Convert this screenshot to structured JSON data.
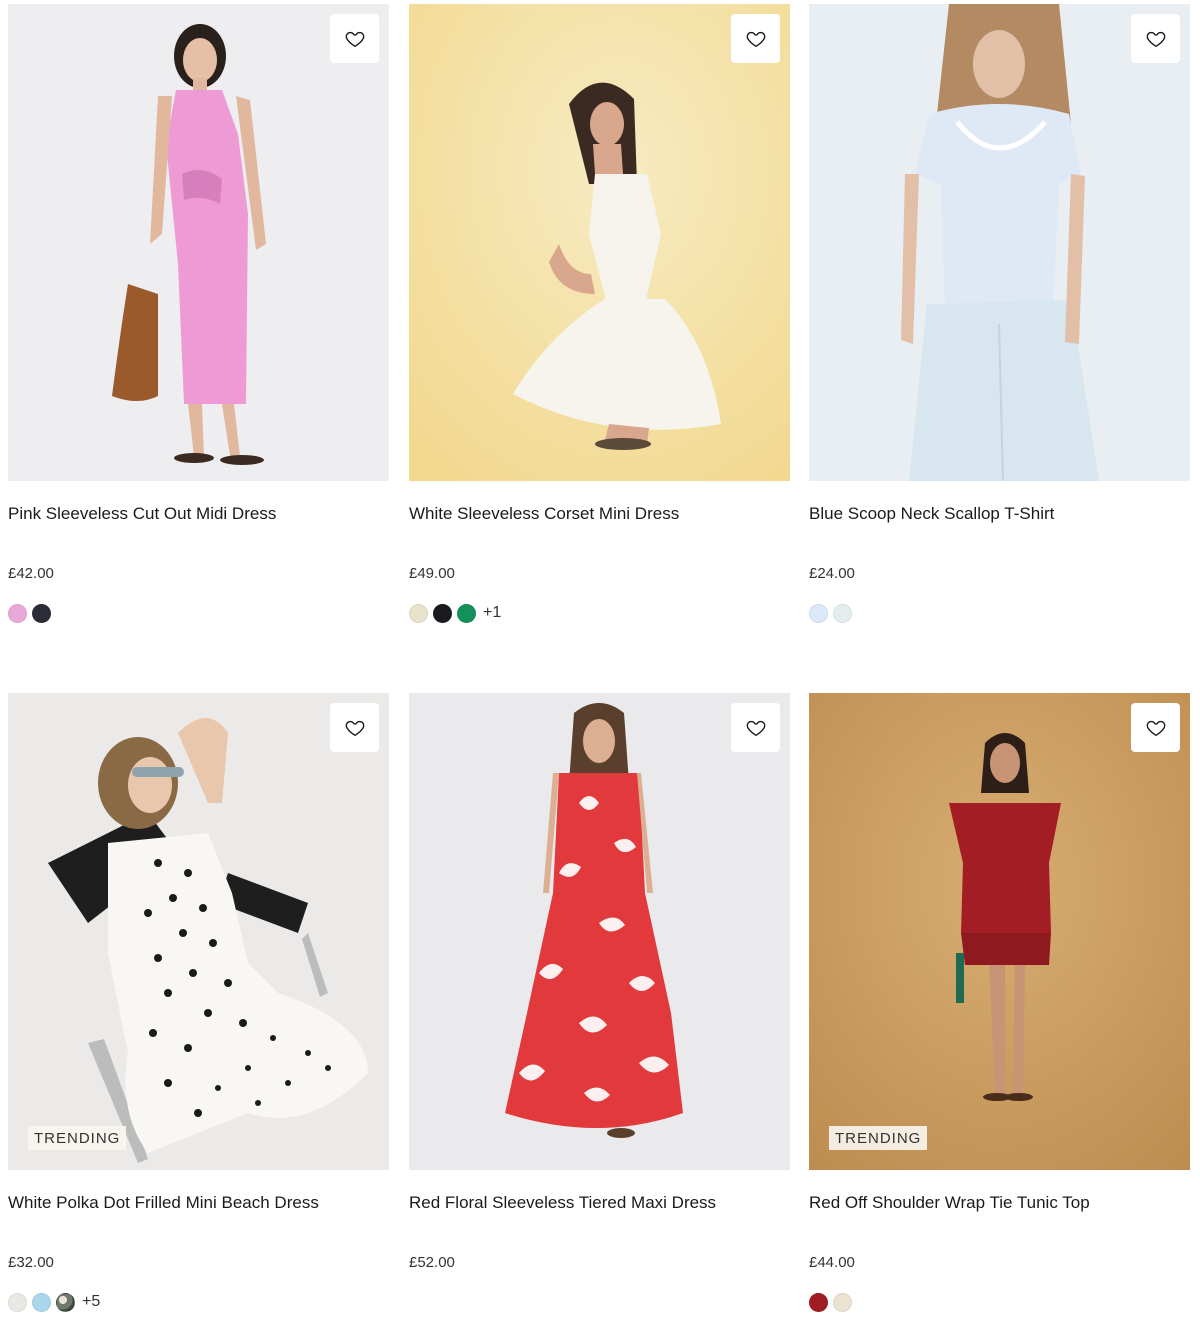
{
  "products": [
    {
      "title": "Pink Sleeveless Cut Out Midi Dress",
      "price": "£42.00",
      "badge": "",
      "image_bg": "#eeeef0",
      "swatches": [
        "#e9a9d8",
        "#2b2c38"
      ],
      "more": ""
    },
    {
      "title": "White Sleeveless Corset Mini Dress",
      "price": "£49.00",
      "badge": "",
      "image_bg": "#f4e2a9",
      "swatches": [
        "#e7e2cc",
        "#1b1b1f",
        "#14915a"
      ],
      "more": "+1"
    },
    {
      "title": "Blue Scoop Neck Scallop T-Shirt",
      "price": "£24.00",
      "badge": "",
      "image_bg": "#e9eef2",
      "swatches": [
        "#dbe9f8",
        "#e3ecef"
      ],
      "more": ""
    },
    {
      "title": "White Polka Dot Frilled Mini Beach Dress",
      "price": "£32.00",
      "badge": "TRENDING",
      "image_bg": "#eceae8",
      "swatches": [
        "#e9e8e4",
        "#a9d6ea",
        "#6f7a6a"
      ],
      "more": "+5"
    },
    {
      "title": "Red Floral Sleeveless Tiered Maxi Dress",
      "price": "£52.00",
      "badge": "",
      "image_bg": "#eaeaec",
      "swatches": [],
      "more": ""
    },
    {
      "title": "Red Off Shoulder Wrap Tie Tunic Top",
      "price": "£44.00",
      "badge": "TRENDING",
      "image_bg": "#c99a5c",
      "swatches": [
        "#a11d24",
        "#ece2d2"
      ],
      "more": ""
    }
  ],
  "icons": {
    "wishlist": "heart-outline-icon"
  }
}
